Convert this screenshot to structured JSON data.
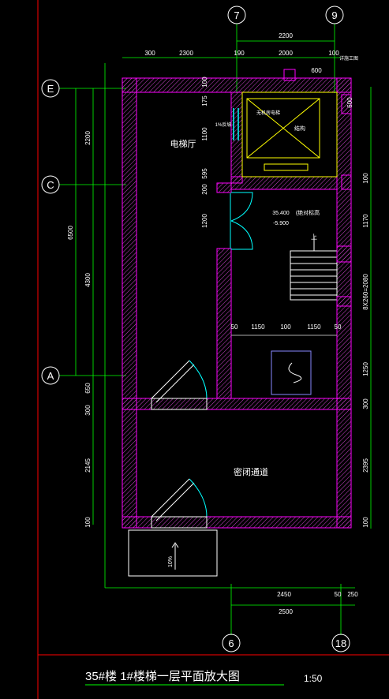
{
  "axes": {
    "top": [
      "7",
      "9"
    ],
    "bottom": [
      "6",
      "18"
    ],
    "left": [
      "E",
      "C",
      "A"
    ]
  },
  "rooms": {
    "elevator_hall": "电梯厅",
    "closed_passage": "密闭通道",
    "elevator_note": "无机房电梯",
    "structure": "结构",
    "slope": "1%反坡",
    "elevation": "35.400",
    "elevation_note": "(绝对标高",
    "elevation_rel": "-5.900",
    "up": "上",
    "ramp": "10%",
    "top_note": "详施工图"
  },
  "dims_top": {
    "d2200": "2200",
    "d300": "300",
    "d2300": "2300",
    "d190": "190",
    "d2000": "2000",
    "d100": "100",
    "d600": "600"
  },
  "dims_left": {
    "d6500": "6500",
    "d2200": "2200",
    "d4300": "4300",
    "d650": "650",
    "d300": "300",
    "d2145": "2145",
    "d100": "100"
  },
  "dims_inner": {
    "d1100": "1100",
    "d175": "175",
    "d100": "100",
    "d595": "595",
    "d200": "200",
    "d1200": "1200"
  },
  "dims_right": {
    "d600": "600",
    "d100": "100",
    "d1170": "1170",
    "stair": "8X260=2080",
    "d1250": "1250",
    "d300": "300",
    "d2395": "2395",
    "d100b": "100"
  },
  "dims_stair": {
    "d50": "50",
    "d1150": "1150",
    "d100": "100",
    "d1150b": "1150",
    "d50b": "50"
  },
  "dims_bottom": {
    "d2450": "2450",
    "d50": "50",
    "d250": "250",
    "d2500": "2500"
  },
  "title": {
    "main": "35#楼  1#楼梯一层平面放大图",
    "scale": "1:50"
  }
}
